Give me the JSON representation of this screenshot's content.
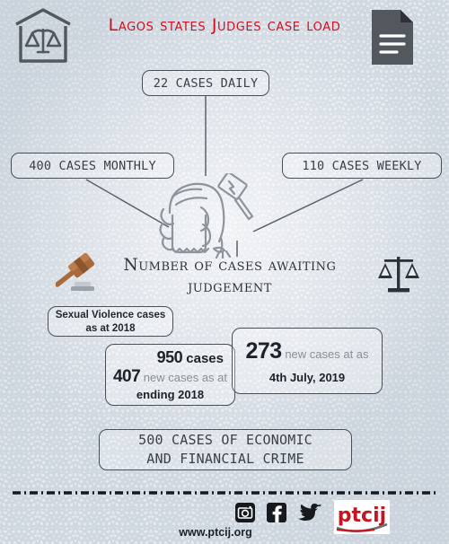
{
  "poster": {
    "title": "Lagos states Judges case load",
    "title_color": "#cc1020",
    "background_color": "#e3e8ed",
    "pattern_name": "seigaiha-wave-pattern"
  },
  "header_icons": {
    "left": "courthouse-scales-icon",
    "right": "document-icon"
  },
  "case_load": {
    "daily": "22 cases daily",
    "monthly": "400 cases monthly",
    "weekly": "110 cases weekly",
    "center_illustration": "judge-wig-and-gavel-icon"
  },
  "awaiting": {
    "heading_line1": "Number of cases awaiting",
    "heading_line2": "judgement",
    "left_icon": "gavel-icon",
    "right_icon": "scales-of-justice-icon",
    "sexual_violence": {
      "line1": "Sexual Violence cases",
      "line2": "as at 2018"
    },
    "box_950": {
      "number_total": "950",
      "label_total": "cases",
      "number_new": "407",
      "label_new": "new cases as at",
      "period": "ending 2018"
    },
    "box_273": {
      "number": "273",
      "label": "new cases at as",
      "date": "4th July, 2019"
    }
  },
  "economic": {
    "line1": "500 cases of economic",
    "line2": "and financial crime"
  },
  "footer": {
    "social": [
      {
        "name": "instagram-icon",
        "label": "Instagram"
      },
      {
        "name": "facebook-icon",
        "label": "Facebook"
      },
      {
        "name": "twitter-icon",
        "label": "Twitter"
      }
    ],
    "logo_text": "ptcij",
    "logo_color": "#c41622",
    "url": "www.ptcij.org"
  }
}
